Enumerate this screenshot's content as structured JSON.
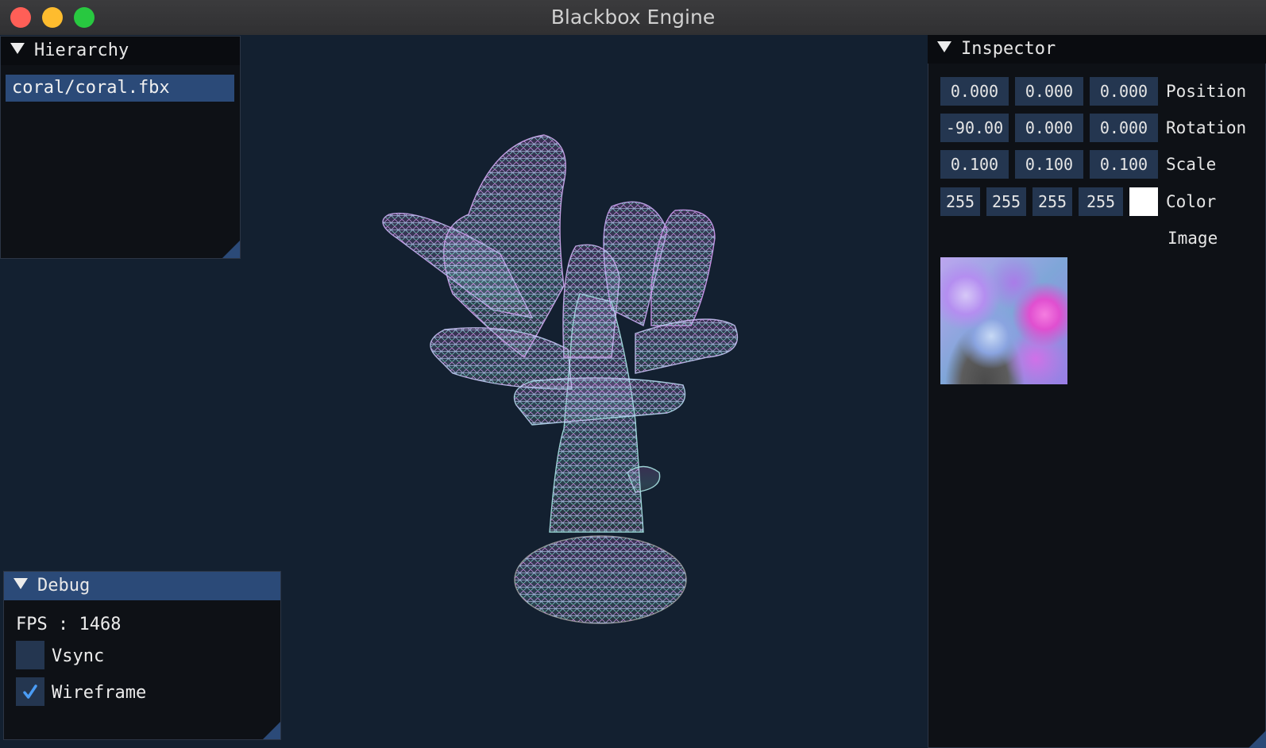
{
  "window": {
    "title": "Blackbox Engine"
  },
  "hierarchy": {
    "title": "Hierarchy",
    "items": [
      {
        "label": "coral/coral.fbx",
        "selected": true
      }
    ]
  },
  "inspector": {
    "title": "Inspector",
    "position": {
      "label": "Position",
      "x": "0.000",
      "y": "0.000",
      "z": "0.000"
    },
    "rotation": {
      "label": "Rotation",
      "x": "-90.00",
      "y": "0.000",
      "z": "0.000"
    },
    "scale": {
      "label": "Scale",
      "x": "0.100",
      "y": "0.100",
      "z": "0.100"
    },
    "color": {
      "label": "Color",
      "r": "255",
      "g": "255",
      "b": "255",
      "a": "255",
      "swatch": "#ffffff"
    },
    "image": {
      "label": "Image"
    }
  },
  "debug": {
    "title": "Debug",
    "fps_label": "FPS : 1468",
    "vsync": {
      "label": "Vsync",
      "checked": false
    },
    "wireframe": {
      "label": "Wireframe",
      "checked": true
    }
  },
  "colors": {
    "accent": "#2b4a78",
    "field": "#243650",
    "viewport": "#132030",
    "panel": "#0e1116",
    "check": "#4a9cf5"
  },
  "icons": {
    "collapse": "triangle-down-icon",
    "check": "checkmark-icon",
    "resize": "resize-grip-icon"
  }
}
